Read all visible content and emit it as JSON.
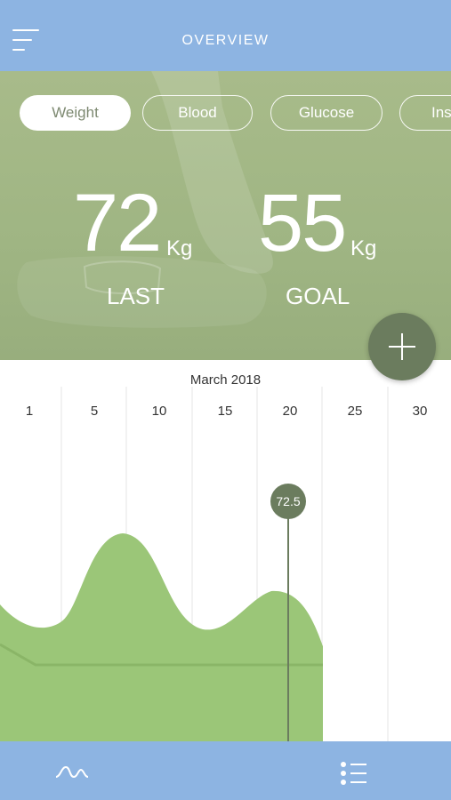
{
  "header": {
    "title": "OVERVIEW",
    "menu_icon": "hamburger-menu-icon"
  },
  "tabs": [
    {
      "label": "Weight",
      "active": true
    },
    {
      "label": "Blood",
      "active": false
    },
    {
      "label": "Glucose",
      "active": false
    },
    {
      "label": "Ins",
      "active": false
    }
  ],
  "stats": {
    "last": {
      "value": "72",
      "unit": "Kg",
      "label": "LAST"
    },
    "goal": {
      "value": "55",
      "unit": "Kg",
      "label": "GOAL"
    }
  },
  "add_icon": "plus-icon",
  "chart_data": {
    "type": "area",
    "title": "March 2018",
    "x_ticks": [
      "1",
      "5",
      "10",
      "15",
      "20",
      "25",
      "30"
    ],
    "selected": {
      "day": 20,
      "value": "72.5"
    },
    "colors": {
      "fill": "#9bc678",
      "line": "#6b7c5e",
      "pin": "#6b7c5e"
    }
  },
  "bottom_nav": {
    "left_icon": "activity-wave-icon",
    "right_icon": "list-icon"
  },
  "colors": {
    "bar": "#8db4e2",
    "hero": "#a4b986",
    "accent": "#6b7c5e"
  }
}
